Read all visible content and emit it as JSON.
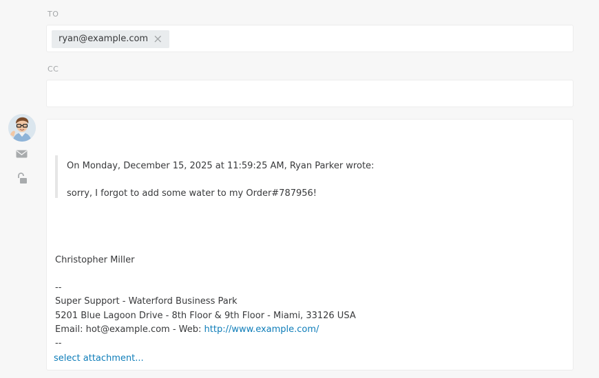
{
  "to": {
    "label": "TO",
    "recipients": [
      {
        "email": "ryan@example.com",
        "remove_glyph": "×"
      }
    ]
  },
  "cc": {
    "label": "CC",
    "value": ""
  },
  "sidebar": {
    "avatar_name": "avatar",
    "icons": [
      "email-icon",
      "unlock-icon"
    ]
  },
  "editor": {
    "quote_header": "On Monday, December 15, 2025 at 11:59:25 AM, Ryan Parker wrote:",
    "quote_body": "sorry, I forgot to add some water to my Order#787956!",
    "signature": {
      "name": "Christopher Miller",
      "separator_top": "--",
      "company": "Super Support - Waterford Business Park",
      "address": "5201 Blue Lagoon Drive - 8th Floor & 9th Floor - Miami, 33126 USA",
      "contact_prefix": "Email: hot@example.com - Web: ",
      "web_link": "http://www.example.com/",
      "separator_bottom": "--"
    },
    "attachment_link": "select attachment..."
  },
  "colors": {
    "background": "#f7f7f7",
    "link": "#0e7db9",
    "label": "#a3a6a8"
  }
}
